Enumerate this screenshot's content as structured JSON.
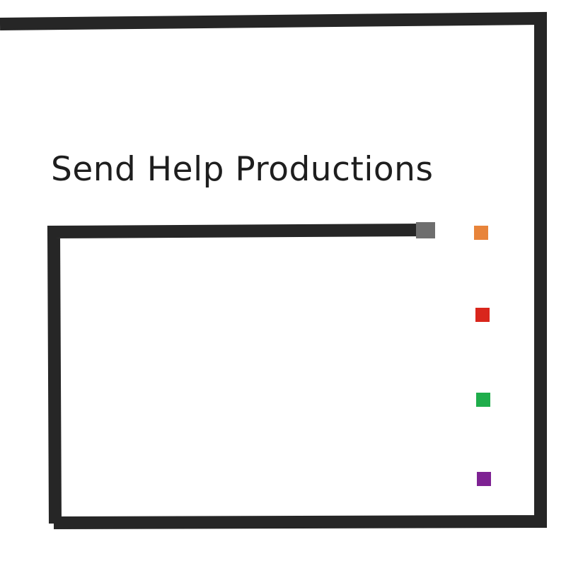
{
  "logo": {
    "title": "Send Help Productions",
    "frame_color": "#262626",
    "handle_color": "#6e6e6e",
    "text_color": "#1e1e1e",
    "squares": [
      {
        "name": "orange-square",
        "color": "#e8843a"
      },
      {
        "name": "red-square",
        "color": "#d9261c"
      },
      {
        "name": "green-square",
        "color": "#1fad4b"
      },
      {
        "name": "purple-square",
        "color": "#7e2293"
      }
    ]
  }
}
